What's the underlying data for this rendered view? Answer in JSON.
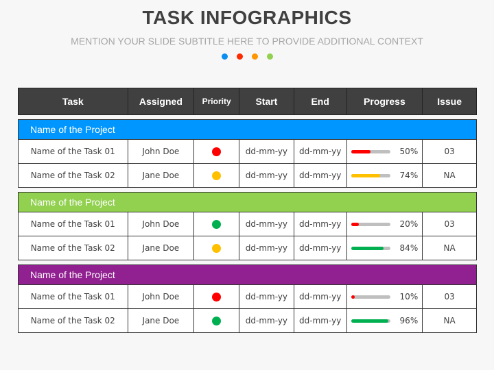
{
  "header": {
    "title": "TASK INFOGRAPHICS",
    "subtitle": "MENTION YOUR SLIDE SUBTITLE HERE TO PROVIDE ADDITIONAL CONTEXT",
    "dots": [
      "#0a8ff0",
      "#ff2a00",
      "#ff9500",
      "#92d050"
    ]
  },
  "table": {
    "columns": [
      "Task",
      "Assigned",
      "Priority",
      "Start",
      "End",
      "Progress",
      "Issue"
    ],
    "projects": [
      {
        "name": "Name of the Project",
        "color": "#0096ff",
        "tasks": [
          {
            "task": "Name of the Task 01",
            "assigned": "John Doe",
            "priority_color": "#ff0000",
            "start": "dd-mm-yy",
            "end": "dd-mm-yy",
            "progress": 50,
            "progress_label": "50%",
            "progress_color": "#ff0000",
            "issue": "03"
          },
          {
            "task": "Name of the Task 02",
            "assigned": "Jane Doe",
            "priority_color": "#ffc000",
            "start": "dd-mm-yy",
            "end": "dd-mm-yy",
            "progress": 74,
            "progress_label": "74%",
            "progress_color": "#ffc000",
            "issue": "NA"
          }
        ]
      },
      {
        "name": "Name of the Project",
        "color": "#92d050",
        "tasks": [
          {
            "task": "Name of the Task 01",
            "assigned": "John Doe",
            "priority_color": "#00b050",
            "start": "dd-mm-yy",
            "end": "dd-mm-yy",
            "progress": 20,
            "progress_label": "20%",
            "progress_color": "#ff0000",
            "issue": "03"
          },
          {
            "task": "Name of the Task 02",
            "assigned": "Jane Doe",
            "priority_color": "#ffc000",
            "start": "dd-mm-yy",
            "end": "dd-mm-yy",
            "progress": 84,
            "progress_label": "84%",
            "progress_color": "#00b050",
            "issue": "NA"
          }
        ]
      },
      {
        "name": "Name of the Project",
        "color": "#912090",
        "tasks": [
          {
            "task": "Name of the Task 01",
            "assigned": "John Doe",
            "priority_color": "#ff0000",
            "start": "dd-mm-yy",
            "end": "dd-mm-yy",
            "progress": 10,
            "progress_label": "10%",
            "progress_color": "#ff0000",
            "issue": "03"
          },
          {
            "task": "Name of the Task 02",
            "assigned": "Jane Doe",
            "priority_color": "#00b050",
            "start": "dd-mm-yy",
            "end": "dd-mm-yy",
            "progress": 96,
            "progress_label": "96%",
            "progress_color": "#00b050",
            "issue": "NA"
          }
        ]
      }
    ]
  }
}
